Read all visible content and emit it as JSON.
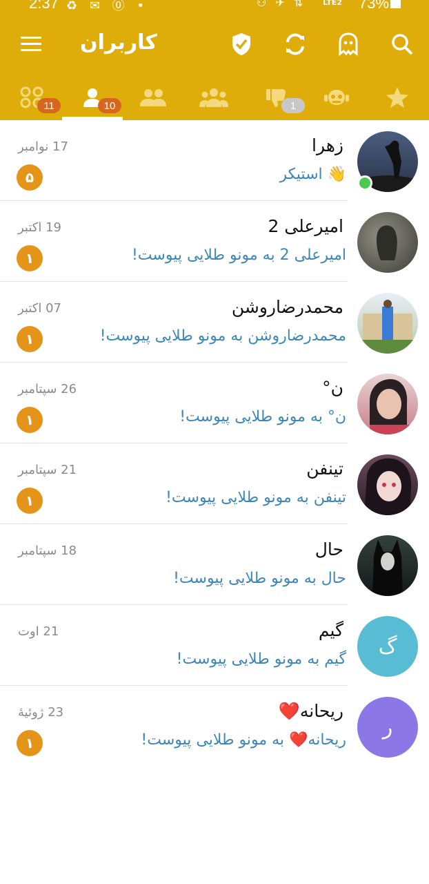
{
  "status_bar": {
    "time": "2:37",
    "left_icons": "♻ ✉ ⓪ •",
    "right_icons": "⚇ ✈ ⇅",
    "network": "LTE2",
    "battery": "73%"
  },
  "toolbar": {
    "title": "کاربران",
    "icons": [
      "menu-icon",
      "shield-check-icon",
      "sync-icon",
      "ghost-icon",
      "search-icon"
    ]
  },
  "tabs": [
    {
      "icon": "grid-icon",
      "badge": "11"
    },
    {
      "icon": "user-icon",
      "badge": "10",
      "active": true
    },
    {
      "icon": "users-icon",
      "badge": ""
    },
    {
      "icon": "group-icon",
      "badge": ""
    },
    {
      "icon": "thumbs-down-icon",
      "badge": "1"
    },
    {
      "icon": "robot-icon",
      "badge": ""
    },
    {
      "icon": "star-icon",
      "badge": ""
    }
  ],
  "chats": [
    {
      "name": "زهرا",
      "message": "👋 استیکر",
      "date": "17 نوامبر",
      "unread": "۵",
      "avatar_color": "#3a4a63",
      "online": true
    },
    {
      "name": "امیرعلی 2",
      "message": "امیرعلی 2 به مونو طلایی پیوست!",
      "date": "19 اکتبر",
      "unread": "۱",
      "avatar_color": "#6b6b5e"
    },
    {
      "name": "محمدرضاروشن",
      "message": "محمدرضاروشن به مونو طلایی پیوست!",
      "date": "07 اکتبر",
      "unread": "۱",
      "avatar_color": "#a9b89a"
    },
    {
      "name": "ن°",
      "message": "ن° به مونو طلایی پیوست!",
      "date": "26 سپتامبر",
      "unread": "۱",
      "avatar_color": "#c78a94"
    },
    {
      "name": "تینفن",
      "message": "تینفن به مونو طلایی پیوست!",
      "date": "21 سپتامبر",
      "unread": "۱",
      "avatar_color": "#4a3644"
    },
    {
      "name": "حال",
      "message": "حال به مونو طلایی پیوست!",
      "date": "18 سپتامبر",
      "unread": "",
      "avatar_color": "#1f2d2a"
    },
    {
      "name": "گیم",
      "message": "گیم به مونو طلایی پیوست!",
      "date": "21 اوت",
      "unread": "",
      "avatar_color": "#58bcd4",
      "letter": "گ"
    },
    {
      "name": "ریحانه❤️",
      "message": "ریحانه❤️ به مونو طلایی پیوست!",
      "date": "23 ژوئیهٔ",
      "unread": "۱",
      "avatar_color": "#8b78e6",
      "letter": "ر"
    }
  ]
}
